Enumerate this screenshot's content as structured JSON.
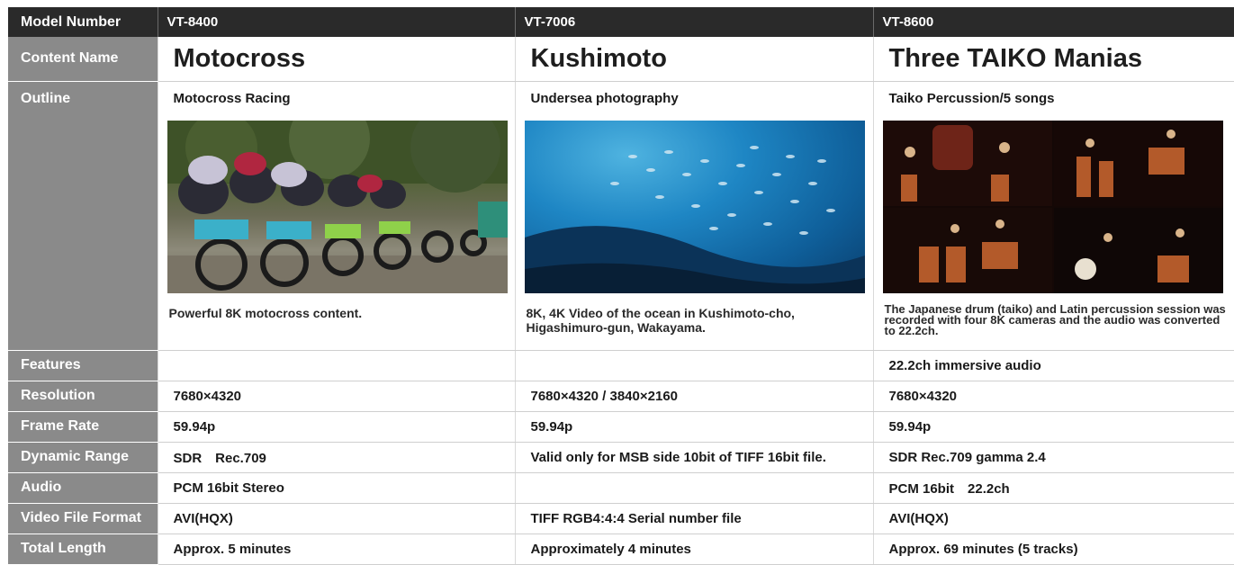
{
  "header": {
    "label": "Model Number",
    "models": [
      "VT-8400",
      "VT-7006",
      "VT-8600"
    ]
  },
  "rows": {
    "content_name": {
      "label": "Content Name",
      "values": [
        "Motocross",
        "Kushimoto",
        "Three TAIKO Manias"
      ]
    },
    "outline": {
      "label": "Outline",
      "titles": [
        "Motocross Racing",
        "Undersea photography",
        "Taiko Percussion/5 songs"
      ],
      "descriptions": [
        "Powerful 8K motocross content.",
        "8K, 4K Video of the ocean in Kushimoto-cho, Higashimuro-gun, Wakayama.",
        "The Japanese drum (taiko) and Latin percussion session was recorded with four 8K cameras and the audio was converted to 22.2ch."
      ]
    },
    "features": {
      "label": "Features",
      "values": [
        "",
        "",
        "22.2ch immersive audio"
      ]
    },
    "resolution": {
      "label": "Resolution",
      "values": [
        "7680×4320",
        "7680×4320 / 3840×2160",
        "7680×4320"
      ]
    },
    "frame_rate": {
      "label": "Frame Rate",
      "values": [
        "59.94p",
        "59.94p",
        "59.94p"
      ]
    },
    "dynamic_range": {
      "label": "Dynamic Range",
      "values": [
        "SDR　Rec.709",
        "Valid only for MSB side 10bit of TIFF 16bit file.",
        "SDR Rec.709 gamma 2.4"
      ]
    },
    "audio": {
      "label": "Audio",
      "values": [
        "PCM 16bit Stereo",
        "",
        "PCM 16bit　22.2ch"
      ]
    },
    "video_file_format": {
      "label": "Video File Format",
      "values": [
        "AVI(HQX)",
        "TIFF RGB4:4:4 Serial number file",
        "AVI(HQX)"
      ]
    },
    "total_length": {
      "label": "Total Length",
      "values": [
        "Approx. 5 minutes",
        "Approximately 4 minutes",
        "Approx. 69 minutes (5 tracks)"
      ]
    }
  },
  "colors": {
    "header_bg": "#2a2a2a",
    "row_header_bg": "#8a8a8a"
  }
}
